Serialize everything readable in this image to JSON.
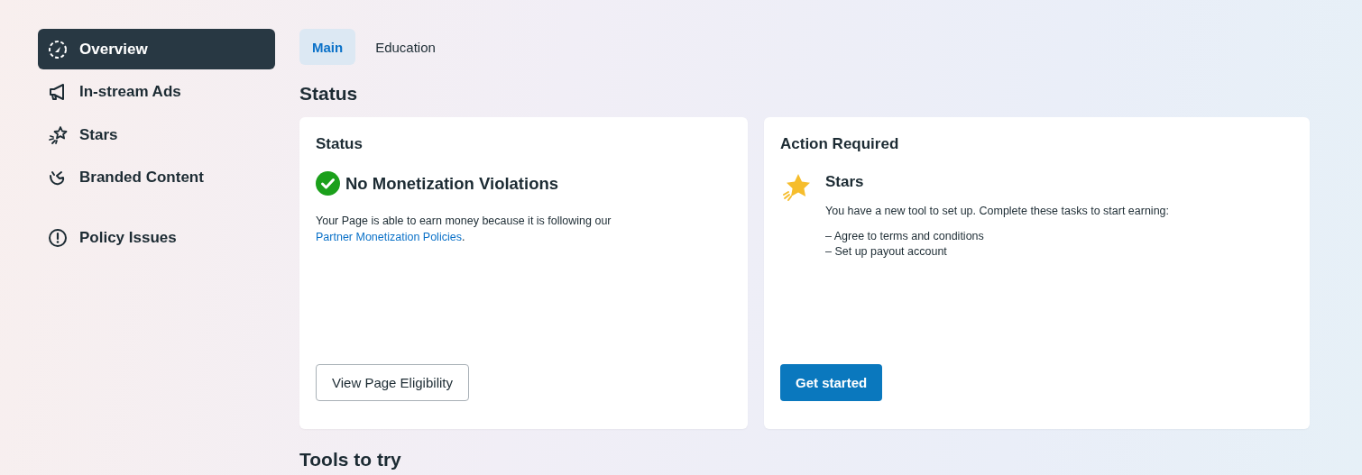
{
  "sidebar": {
    "items": [
      {
        "label": "Overview",
        "selected": true
      },
      {
        "label": "In-stream Ads",
        "selected": false
      },
      {
        "label": "Stars",
        "selected": false
      },
      {
        "label": "Branded Content",
        "selected": false
      },
      {
        "label": "Policy Issues",
        "selected": false
      }
    ]
  },
  "tabs": [
    {
      "label": "Main",
      "selected": true
    },
    {
      "label": "Education",
      "selected": false
    }
  ],
  "status_heading": "Status",
  "status_card": {
    "title": "Status",
    "headline": "No Monetization Violations",
    "text": "Your Page is able to earn money because it is following our",
    "link": "Partner Monetization Policies",
    "text_end": ".",
    "button": "View Page Eligibility"
  },
  "action_card": {
    "title": "Action Required",
    "tool": "Stars",
    "text": "You have a new tool to set up. Complete these tasks to start earning:",
    "tasks": [
      "– Agree to terms and conditions",
      "– Set up payout account"
    ],
    "button": "Get started"
  },
  "tools_heading": "Tools to try"
}
